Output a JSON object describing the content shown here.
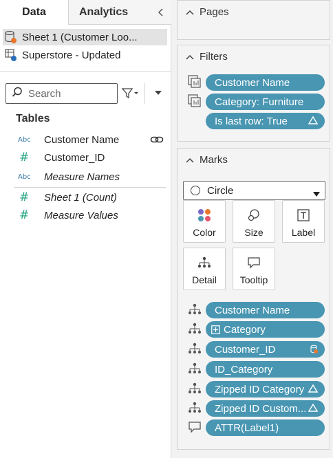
{
  "tabs": {
    "data": "Data",
    "analytics": "Analytics"
  },
  "datasources": [
    {
      "label": "Sheet 1 (Customer Loo...",
      "icon": "datasource-cylinder-icon",
      "selected": true
    },
    {
      "label": "Superstore - Updated",
      "icon": "datasource-published-icon",
      "selected": false
    }
  ],
  "search": {
    "placeholder": "Search",
    "value": ""
  },
  "tables": {
    "title": "Tables",
    "fields": [
      {
        "type": "Abc",
        "name": "Customer Name",
        "italic": false,
        "linked": true
      },
      {
        "type": "#",
        "name": "Customer_ID",
        "italic": false
      },
      {
        "type": "Abc",
        "name": "Measure Names",
        "italic": true
      },
      {
        "type": "#",
        "name": "Sheet 1 (Count)",
        "italic": true
      },
      {
        "type": "#",
        "name": "Measure Values",
        "italic": true
      }
    ]
  },
  "pages": {
    "title": "Pages"
  },
  "filters": {
    "title": "Filters",
    "pills": [
      {
        "label": "Customer Name",
        "icon": "context-filter-icon"
      },
      {
        "label": "Category: Furniture",
        "icon": "context-filter-icon"
      },
      {
        "label": "Is last row: True",
        "delta": true
      }
    ]
  },
  "marks": {
    "title": "Marks",
    "mark_type": "Circle",
    "buttons": [
      "Color",
      "Size",
      "Label",
      "Detail",
      "Tooltip"
    ],
    "pills": [
      {
        "label": "Customer Name",
        "icon": "detail-icon"
      },
      {
        "label": "Category",
        "icon": "detail-icon",
        "expand": true
      },
      {
        "label": "Customer_ID",
        "icon": "detail-icon",
        "datasource_badge": true
      },
      {
        "label": "ID_Category",
        "icon": "detail-icon"
      },
      {
        "label": "Zipped ID Category",
        "icon": "detail-icon",
        "delta": true
      },
      {
        "label": "Zipped ID Custom...",
        "icon": "detail-icon",
        "delta": true
      },
      {
        "label": "ATTR(Label1)",
        "icon": "tooltip-icon"
      }
    ]
  },
  "colors": {
    "pill": "#4996b2",
    "accent_orange": "#e8762d",
    "accent_blue": "#2a6ebb",
    "hash_green": "#21a37e"
  }
}
